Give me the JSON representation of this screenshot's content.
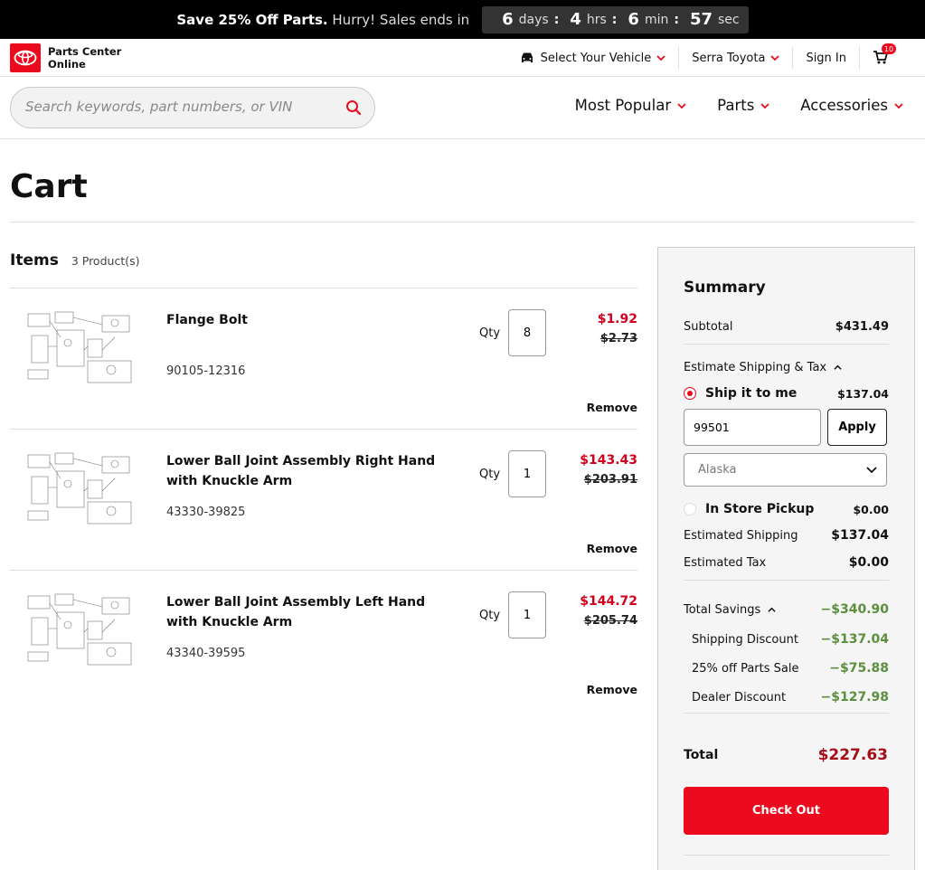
{
  "promo": {
    "bold": "Save 25% Off Parts.",
    "rest": "Hurry! Sales ends in",
    "days": "6",
    "days_label": "days",
    "hrs": "4",
    "hrs_label": "hrs",
    "min": "6",
    "min_label": "min",
    "sec": "57",
    "sec_label": "sec"
  },
  "header": {
    "logo_line1": "Parts Center",
    "logo_line2": "Online",
    "select_vehicle": "Select Your Vehicle",
    "dealer": "Serra Toyota",
    "sign_in": "Sign In",
    "cart_count": "10"
  },
  "search": {
    "placeholder": "Search keywords, part numbers, or VIN"
  },
  "nav": {
    "most_popular": "Most Popular",
    "parts": "Parts",
    "accessories": "Accessories"
  },
  "page": {
    "title": "Cart",
    "items_label": "Items",
    "items_count": "3 Product(s)"
  },
  "items": [
    {
      "name": "Flange Bolt",
      "part_number": "90105-12316",
      "qty_label": "Qty",
      "qty": "8",
      "sale_price": "$1.92",
      "old_price": "$2.73",
      "remove": "Remove"
    },
    {
      "name": "Lower Ball Joint Assembly Right Hand with Knuckle Arm",
      "part_number": "43330-39825",
      "qty_label": "Qty",
      "qty": "1",
      "sale_price": "$143.43",
      "old_price": "$203.91",
      "remove": "Remove"
    },
    {
      "name": "Lower Ball Joint Assembly Left Hand with Knuckle Arm",
      "part_number": "43340-39595",
      "qty_label": "Qty",
      "qty": "1",
      "sale_price": "$144.72",
      "old_price": "$205.74",
      "remove": "Remove"
    }
  ],
  "summary": {
    "title": "Summary",
    "subtotal_label": "Subtotal",
    "subtotal": "$431.49",
    "estimate_label": "Estimate Shipping & Tax",
    "ship_label": "Ship it to me",
    "ship_value": "$137.04",
    "zip": "99501",
    "apply": "Apply",
    "state": "Alaska",
    "pickup_label": "In Store Pickup",
    "pickup_value": "$0.00",
    "est_shipping_label": "Estimated Shipping",
    "est_shipping": "$137.04",
    "est_tax_label": "Estimated Tax",
    "est_tax": "$0.00",
    "savings_label": "Total Savings",
    "savings": "−$340.90",
    "ship_discount_label": "Shipping Discount",
    "ship_discount": "−$137.04",
    "sale_label": "25% off Parts Sale",
    "sale": "−$75.88",
    "dealer_discount_label": "Dealer Discount",
    "dealer_discount": "−$127.98",
    "total_label": "Total",
    "total": "$227.63",
    "checkout": "Check Out"
  },
  "colors": {
    "brand": "#eb0a1e",
    "savings": "#5b8f3e",
    "total": "#a50d1a"
  }
}
